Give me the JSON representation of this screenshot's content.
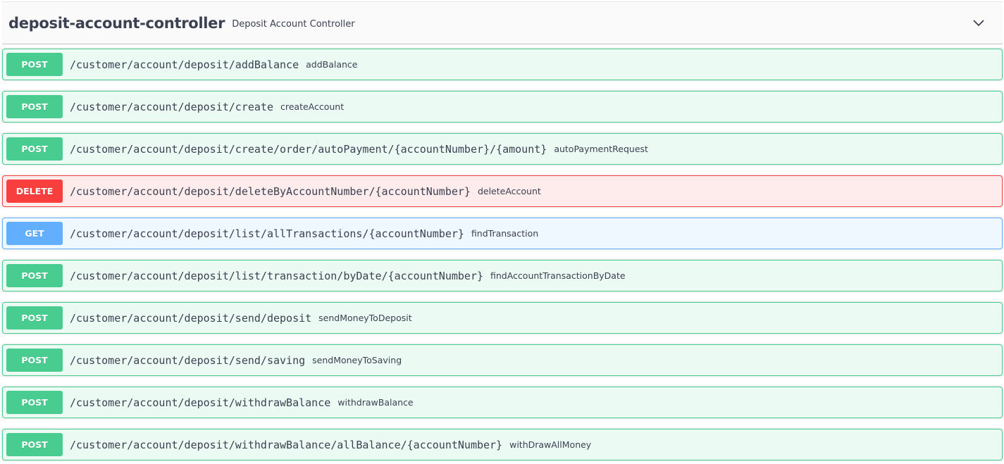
{
  "controller": {
    "name": "deposit-account-controller",
    "description": "Deposit Account Controller",
    "toggle_icon": "chevron-down-icon"
  },
  "colors": {
    "post": "#49cc90",
    "delete": "#f93e3e",
    "get": "#61affe",
    "text": "#3b4151"
  },
  "operations": [
    {
      "method": "POST",
      "path": "/customer/account/deposit/addBalance",
      "summary": "addBalance"
    },
    {
      "method": "POST",
      "path": "/customer/account/deposit/create",
      "summary": "createAccount"
    },
    {
      "method": "POST",
      "path": "/customer/account/deposit/create/order/autoPayment/{accountNumber}/{amount}",
      "summary": "autoPaymentRequest"
    },
    {
      "method": "DELETE",
      "path": "/customer/account/deposit/deleteByAccountNumber/{accountNumber}",
      "summary": "deleteAccount"
    },
    {
      "method": "GET",
      "path": "/customer/account/deposit/list/allTransactions/{accountNumber}",
      "summary": "findTransaction"
    },
    {
      "method": "POST",
      "path": "/customer/account/deposit/list/transaction/byDate/{accountNumber}",
      "summary": "findAccountTransactionByDate"
    },
    {
      "method": "POST",
      "path": "/customer/account/deposit/send/deposit",
      "summary": "sendMoneyToDeposit"
    },
    {
      "method": "POST",
      "path": "/customer/account/deposit/send/saving",
      "summary": "sendMoneyToSaving"
    },
    {
      "method": "POST",
      "path": "/customer/account/deposit/withdrawBalance",
      "summary": "withdrawBalance"
    },
    {
      "method": "POST",
      "path": "/customer/account/deposit/withdrawBalance/allBalance/{accountNumber}",
      "summary": "withDrawAllMoney"
    }
  ]
}
